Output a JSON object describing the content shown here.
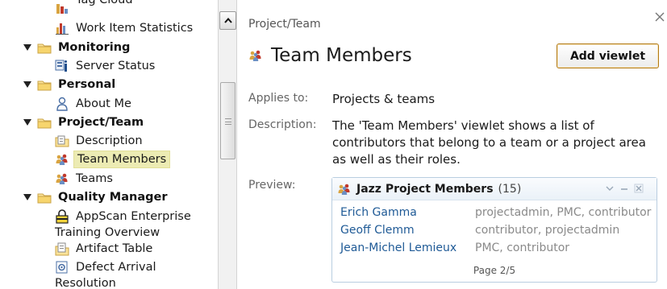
{
  "tree": {
    "items": [
      {
        "label": "Tag Cloud",
        "kind": "leaf"
      },
      {
        "label": "Work Item Statistics",
        "kind": "leaf"
      },
      {
        "label": "Monitoring",
        "kind": "group"
      },
      {
        "label": "Server Status",
        "kind": "leaf"
      },
      {
        "label": "Personal",
        "kind": "group"
      },
      {
        "label": "About Me",
        "kind": "leaf"
      },
      {
        "label": "Project/Team",
        "kind": "group"
      },
      {
        "label": "Description",
        "kind": "leaf"
      },
      {
        "label": "Team Members",
        "kind": "leaf",
        "selected": true
      },
      {
        "label": "Teams",
        "kind": "leaf"
      },
      {
        "label": "Quality Manager",
        "kind": "group"
      },
      {
        "label": "AppScan Enterprise",
        "label_line2": "Training Overview",
        "kind": "leaf"
      },
      {
        "label": "Artifact Table",
        "kind": "leaf"
      },
      {
        "label": "Defect Arrival",
        "label_line2": "Resolution",
        "kind": "leaf"
      }
    ]
  },
  "panel": {
    "breadcrumb": "Project/Team",
    "title": "Team Members",
    "add_button": "Add viewlet",
    "applies_label": "Applies to:",
    "applies_value": "Projects & teams",
    "description_label": "Description:",
    "description_value": "The 'Team Members' viewlet shows a list of contributors that belong to a team or a project area as well as their roles.",
    "preview_label": "Preview:",
    "preview": {
      "title": "Jazz Project Members",
      "count": "(15)",
      "members": [
        {
          "name": "Erich Gamma",
          "roles": "projectadmin, PMC, contributor"
        },
        {
          "name": "Geoff Clemm",
          "roles": "contributor, projectadmin"
        },
        {
          "name": "Jean-Michel Lemieux",
          "roles": "PMC, contributor"
        }
      ],
      "page": "Page 2/5"
    }
  },
  "colors": {
    "selection": "#ecebb3",
    "link": "#1f5a96",
    "button_border": "#b27a18",
    "preview_border": "#b9cde0"
  }
}
